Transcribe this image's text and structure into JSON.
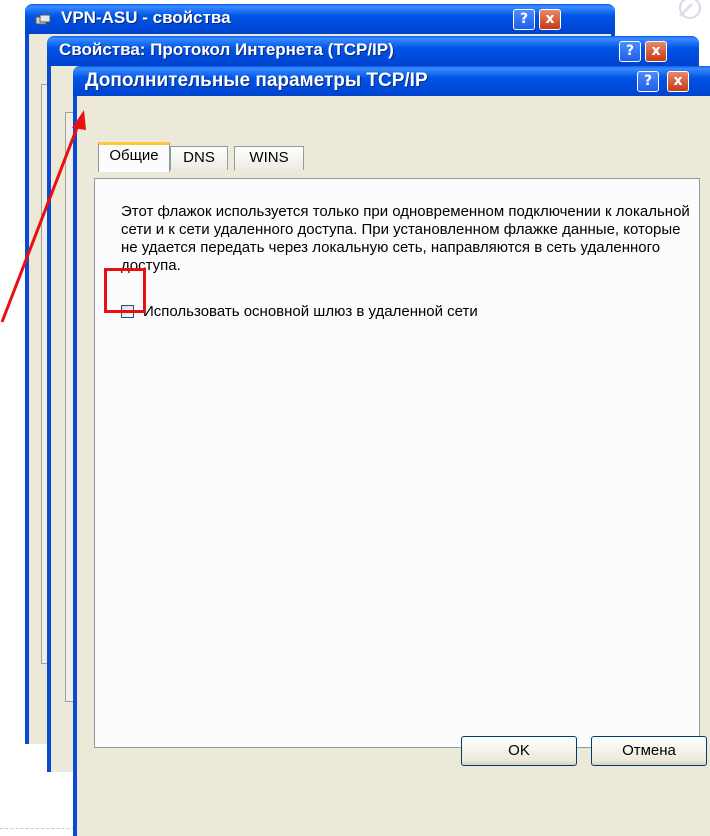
{
  "window_back1": {
    "title": "VPN-ASU - свойства",
    "help_button": "?",
    "close_button": "x"
  },
  "window_back2": {
    "title": "Свойства: Протокол Интернета (TCP/IP)",
    "help_button": "?",
    "close_button": "x"
  },
  "dialog": {
    "title": "Дополнительные параметры TCP/IP",
    "help_button": "?",
    "close_button": "x",
    "tabs": [
      {
        "label": "Общие",
        "active": true
      },
      {
        "label": "DNS",
        "active": false
      },
      {
        "label": "WINS",
        "active": false
      }
    ],
    "description": "Этот флажок используется только при одновременном подключении к локальной сети и к сети удаленного доступа. При установленном флажке данные, которые не удается передать через локальную сеть, направляются в сеть удаленного доступа.",
    "checkbox_label": "Использовать основной шлюз в удаленной сети",
    "checkbox_checked": false,
    "ok_button": "OK",
    "cancel_button": "Отмена"
  },
  "colors": {
    "title_bar": "#0055e5",
    "highlight": "#e81010",
    "tab_accent": "#ffc83c"
  }
}
